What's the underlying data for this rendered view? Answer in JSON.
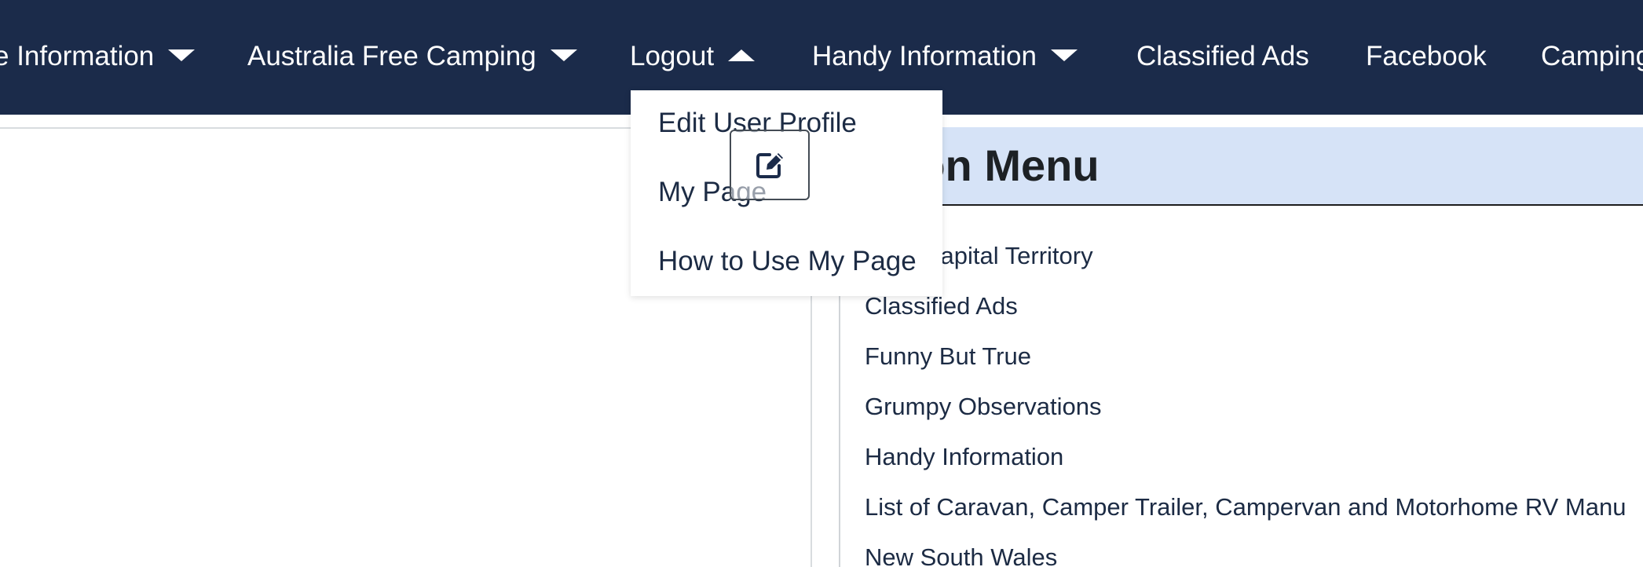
{
  "navbar": {
    "items": [
      {
        "label": "e Information",
        "caret": "down"
      },
      {
        "label": "Australia Free Camping",
        "caret": "down"
      },
      {
        "label": "Logout",
        "caret": "up"
      },
      {
        "label": "Handy Information",
        "caret": "down"
      },
      {
        "label": "Classified Ads"
      },
      {
        "label": "Facebook"
      },
      {
        "label": "Camping"
      }
    ]
  },
  "dropdown": {
    "items": [
      {
        "label": "Edit User Profile"
      },
      {
        "label": "My Page"
      },
      {
        "label": "How to Use My Page"
      }
    ]
  },
  "edit_tooltip": {
    "icon": "edit-icon"
  },
  "section": {
    "title": "ction Menu",
    "links": [
      {
        "label": "alian Capital Territory"
      },
      {
        "label": "Classified Ads"
      },
      {
        "label": "Funny But True"
      },
      {
        "label": "Grumpy Observations"
      },
      {
        "label": "Handy Information"
      },
      {
        "label": "List of Caravan, Camper Trailer, Campervan and Motorhome RV Manu"
      },
      {
        "label": "New South Wales"
      }
    ]
  },
  "colors": {
    "navbar_bg": "#1b2b4a",
    "nav_text": "#ffffff",
    "section_header_bg": "#d6e3f7",
    "link_text": "#1c2b44"
  }
}
